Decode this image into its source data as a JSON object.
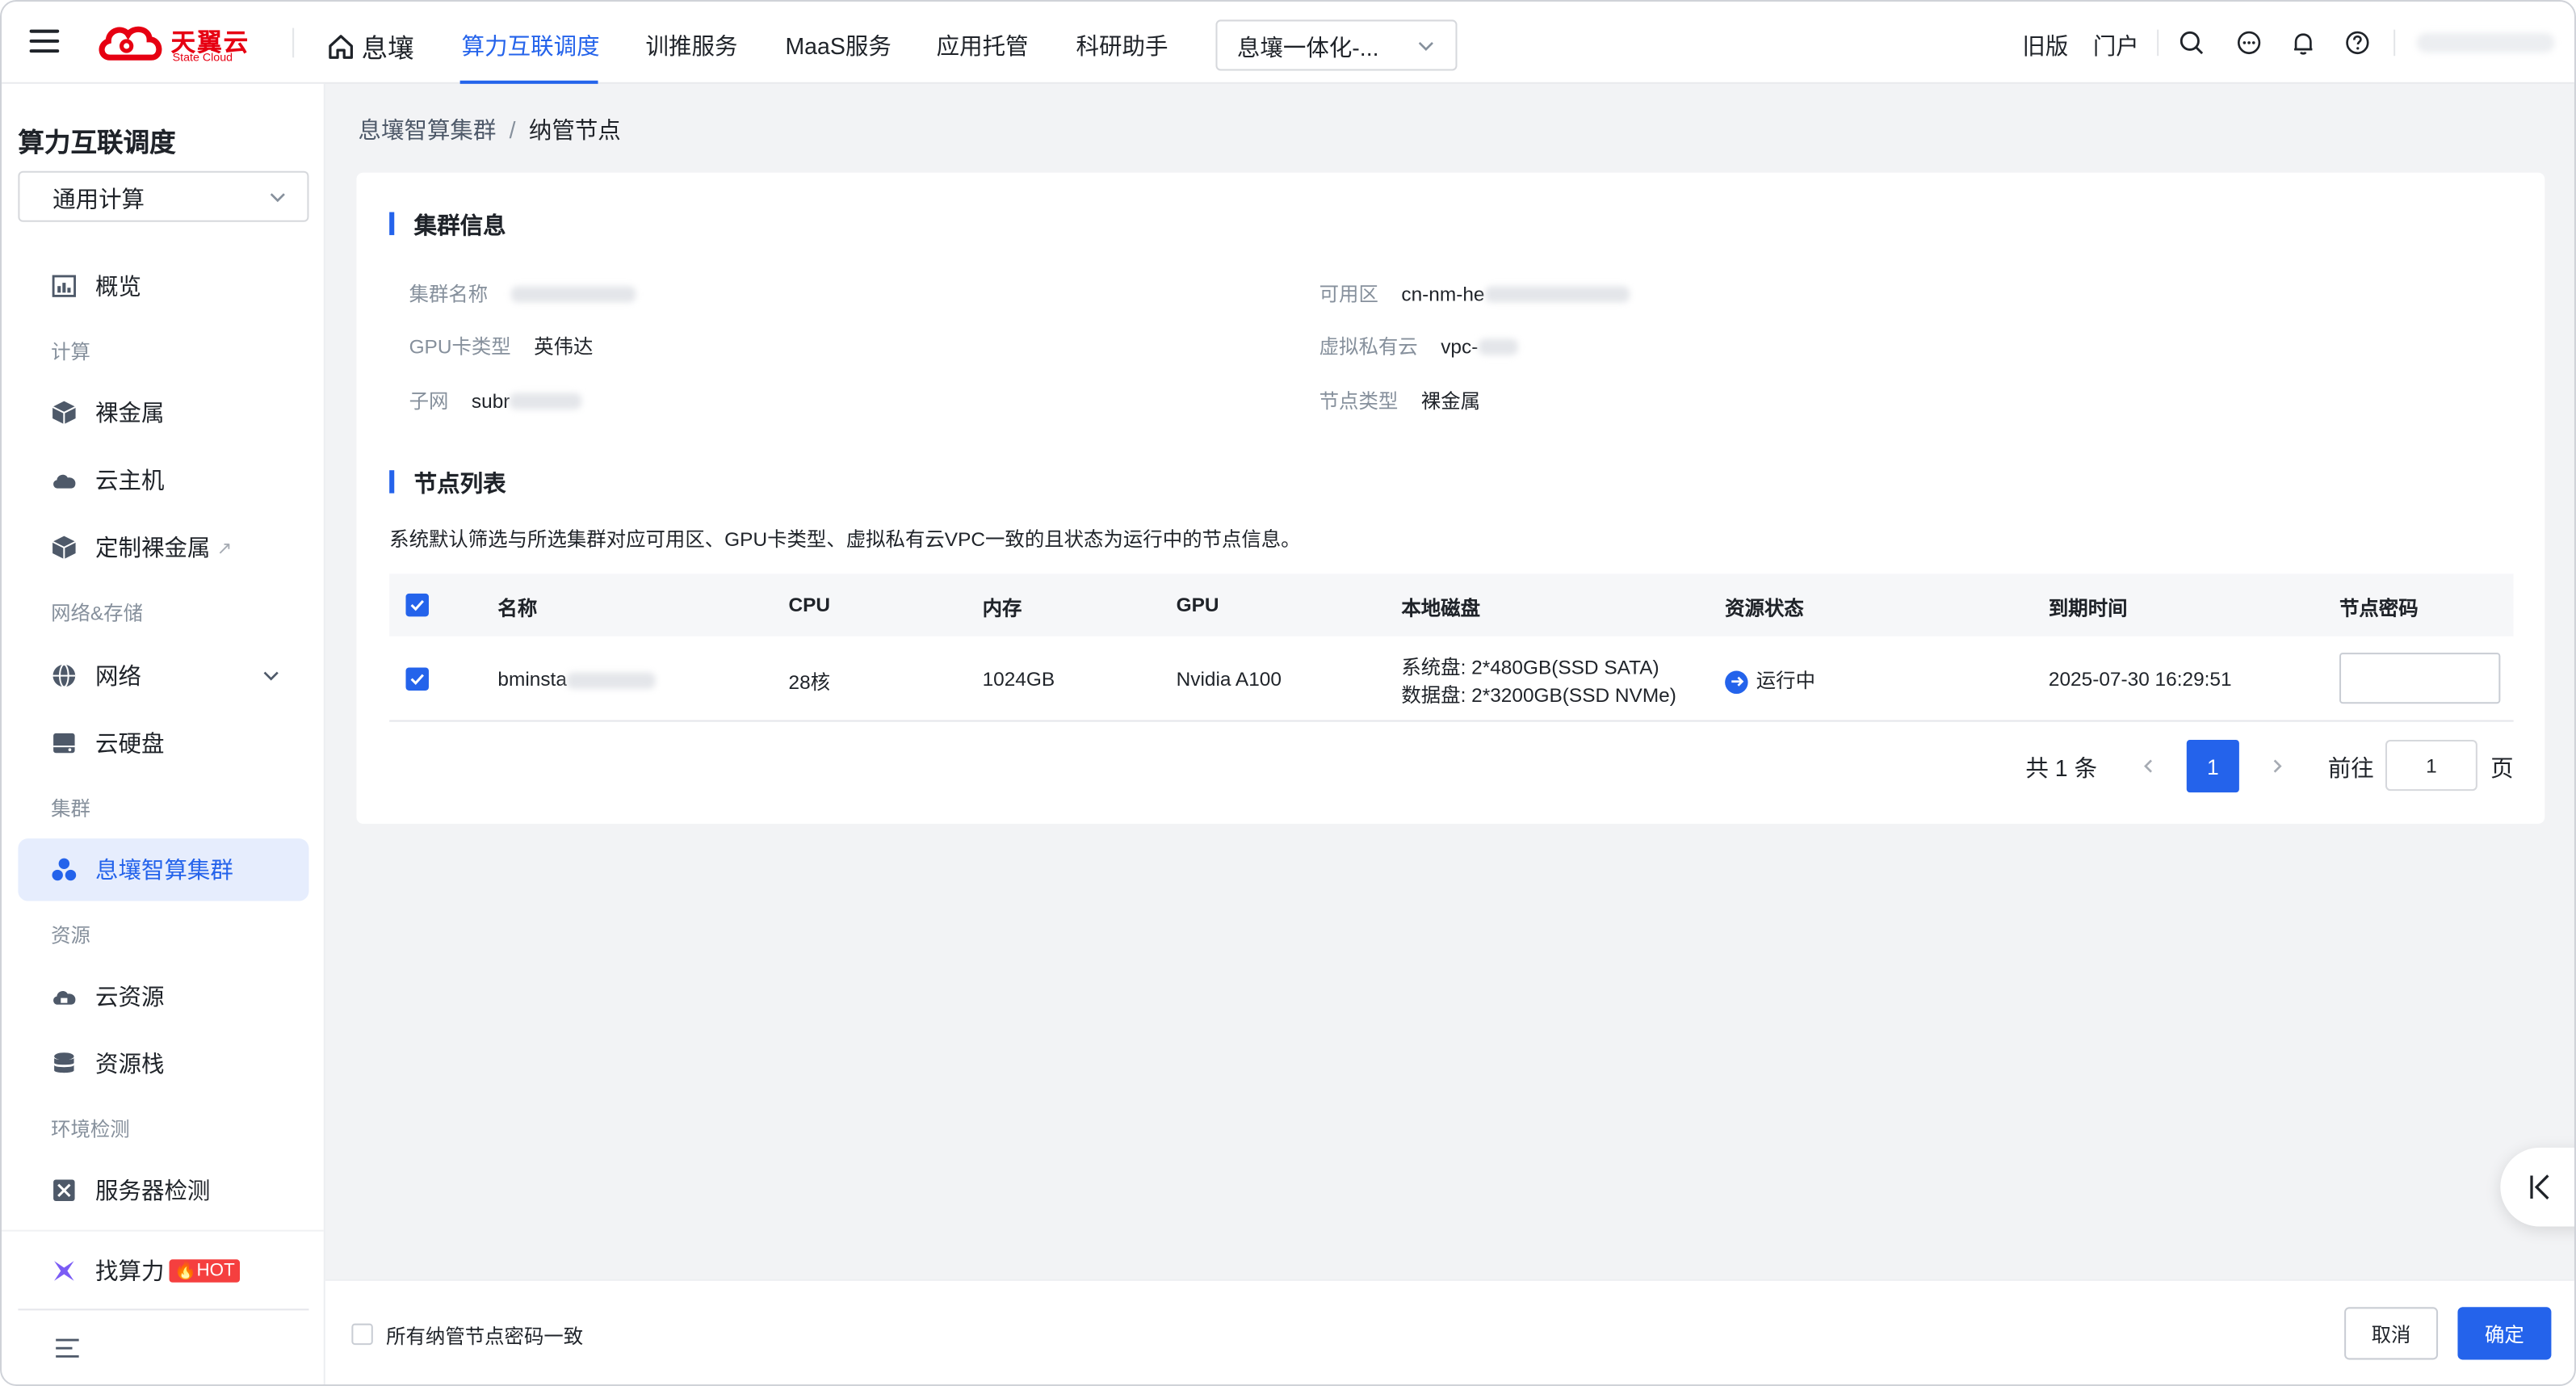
{
  "brand": {
    "name_cn": "天翼云",
    "name_en": "State Cloud",
    "color": "#e60012"
  },
  "topnav": {
    "home": "息壤",
    "items": [
      "算力互联调度",
      "训推服务",
      "MaaS服务",
      "应用托管",
      "科研助手"
    ],
    "workspace": "息壤一体化-...",
    "links": [
      "旧版",
      "门户"
    ]
  },
  "sidebar": {
    "title": "算力互联调度",
    "select": "通用计算",
    "overview": "概览",
    "groups": {
      "compute": "计算",
      "network": "网络&存储",
      "cluster": "集群",
      "resource": "资源",
      "env": "环境检测"
    },
    "items": {
      "bare_metal": "裸金属",
      "cloud_host": "云主机",
      "custom_bare_metal": "定制裸金属",
      "network": "网络",
      "cloud_disk": "云硬盘",
      "cluster": "息壤智算集群",
      "cloud_resource": "云资源",
      "resource_stack": "资源栈",
      "server_check": "服务器检测",
      "find_compute": "找算力",
      "hot": "HOT"
    }
  },
  "breadcrumb": {
    "parent": "息壤智算集群",
    "sep": "/",
    "current": "纳管节点"
  },
  "cluster_info": {
    "title": "集群信息",
    "name_label": "集群名称",
    "zone_label": "可用区",
    "zone_value": "cn-nm-he",
    "gpu_label": "GPU卡类型",
    "gpu_value": "英伟达",
    "vpc_label": "虚拟私有云",
    "vpc_value": "vpc-",
    "subnet_label": "子网",
    "subnet_value": "subr",
    "node_type_label": "节点类型",
    "node_type_value": "裸金属"
  },
  "node_list": {
    "title": "节点列表",
    "desc": "系统默认筛选与所选集群对应可用区、GPU卡类型、虚拟私有云VPC一致的且状态为运行中的节点信息。",
    "columns": [
      "名称",
      "CPU",
      "内存",
      "GPU",
      "本地磁盘",
      "资源状态",
      "到期时间",
      "节点密码"
    ],
    "rows": [
      {
        "name": "bminsta",
        "cpu": "28核",
        "memory": "1024GB",
        "gpu": "Nvidia A100",
        "disk_sys": "系统盘: 2*480GB(SSD SATA)",
        "disk_data": "数据盘: 2*3200GB(SSD NVMe)",
        "status": "运行中",
        "expire": "2025-07-30 16:29:51"
      }
    ]
  },
  "pager": {
    "total": "共 1 条",
    "current": "1",
    "goto": "前往",
    "goto_value": "1",
    "page": "页"
  },
  "footer": {
    "same_pwd": "所有纳管节点密码一致",
    "cancel": "取消",
    "ok": "确定"
  },
  "colors": {
    "primary": "#2463eb",
    "danger": "#f53f3f"
  }
}
